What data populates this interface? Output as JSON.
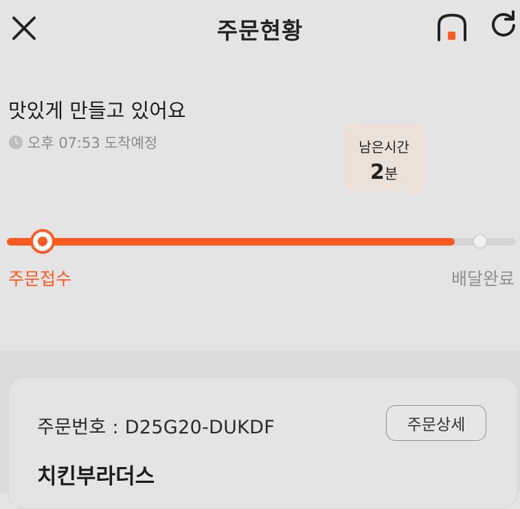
{
  "header": {
    "title": "주문현황"
  },
  "status": {
    "heading": "맛있게 만들고 있어요",
    "eta_time": "오후 07:53",
    "eta_suffix": "도착예정",
    "remaining_label": "남은시간",
    "remaining_value": "2",
    "remaining_unit": "분"
  },
  "progress": {
    "fraction": 0.88,
    "start_label": "주문접수",
    "end_label": "배달완료"
  },
  "order": {
    "number_label": "주문번호 : ",
    "number": "D25G20-DUKDF",
    "detail_button": "주문상세",
    "store_name": "치킨부라더스"
  },
  "colors": {
    "accent": "#ff5a21",
    "background": "#e4e4e4",
    "muted_text": "#8a8a8a",
    "bubble": "#ebe1d8"
  },
  "icons": {
    "close": "close-icon",
    "home": "home-icon",
    "refresh": "refresh-icon",
    "clock": "clock-icon"
  }
}
